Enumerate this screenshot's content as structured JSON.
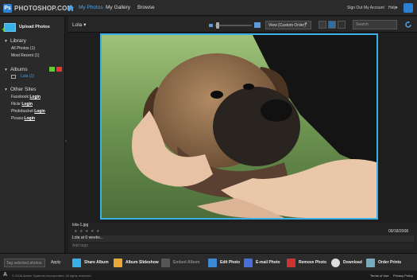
{
  "app": {
    "logo_text": "PHOTOSHOP.COM",
    "logo_mark": "Ps"
  },
  "topnav": {
    "my_photos": "My Photos",
    "my_gallery": "My Gallery",
    "browse": "Browse",
    "sign_out": "Sign Out",
    "my_account": "My Account",
    "help": "Help",
    "help_chevron": "▾"
  },
  "toolbar": {
    "album_title": "Lola ▾",
    "view_option": "View (Custom Order)",
    "view_chevron": "▾",
    "search_placeholder": "Search"
  },
  "sidebar": {
    "upload_label": "Upload Photos",
    "library": {
      "heading": "Library",
      "items": [
        "All Photos (1)",
        "Most Recent (1)"
      ]
    },
    "albums": {
      "heading": "Albums",
      "items": [
        "Lola (1)"
      ]
    },
    "other_sites": {
      "heading": "Other Sites",
      "sites": [
        {
          "name": "Facebook",
          "action": "Login"
        },
        {
          "name": "Flickr",
          "action": "Login"
        },
        {
          "name": "Photobucket",
          "action": "Login"
        },
        {
          "name": "Picasa",
          "action": "Login"
        }
      ]
    }
  },
  "photo": {
    "file_name": "lola-1.jpg",
    "date": "09/18/2008",
    "rating": 0,
    "caption": "Lola at 6 weeks...",
    "tags_placeholder": "Add tags"
  },
  "actionbar": {
    "tag_placeholder": "Tag selected photos",
    "apply": "Apply",
    "actions": [
      "Share Album",
      "Album Slideshow",
      "Embed Album",
      "Edit Photo",
      "E-mail Photo",
      "Remove Photo",
      "Download",
      "Order Prints"
    ]
  },
  "footer": {
    "adobe_logo": "A",
    "copyright": "© 2008 Adobe Systems Incorporated. All rights reserved.",
    "terms": "Terms of Use",
    "privacy": "Privacy Policy"
  },
  "colors": {
    "accent": "#3bb0e6",
    "link_active": "#4aa3e8",
    "background": "#1e1e1e"
  }
}
